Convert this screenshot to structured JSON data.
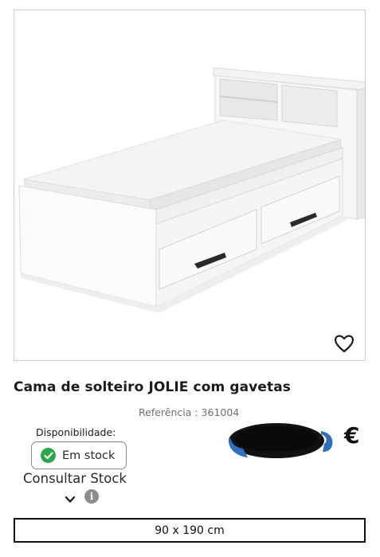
{
  "product": {
    "title": "Cama de solteiro JOLIE com gavetas",
    "reference": "Referência : 361004",
    "image_alt": "Cama de solteiro branca com gavetas e cabeceira com prateleiras"
  },
  "availability": {
    "label": "Disponibilidade:",
    "status": "Em stock",
    "status_color": "#29a84a",
    "consult_label": "Consultar Stock"
  },
  "price": {
    "currency": "€",
    "value_redacted": true
  },
  "size": {
    "label": "90 x 190 cm"
  },
  "icons": {
    "wishlist": "heart-icon",
    "check": "check-circle-icon",
    "expand": "chevron-down-icon",
    "info": "info-icon"
  }
}
